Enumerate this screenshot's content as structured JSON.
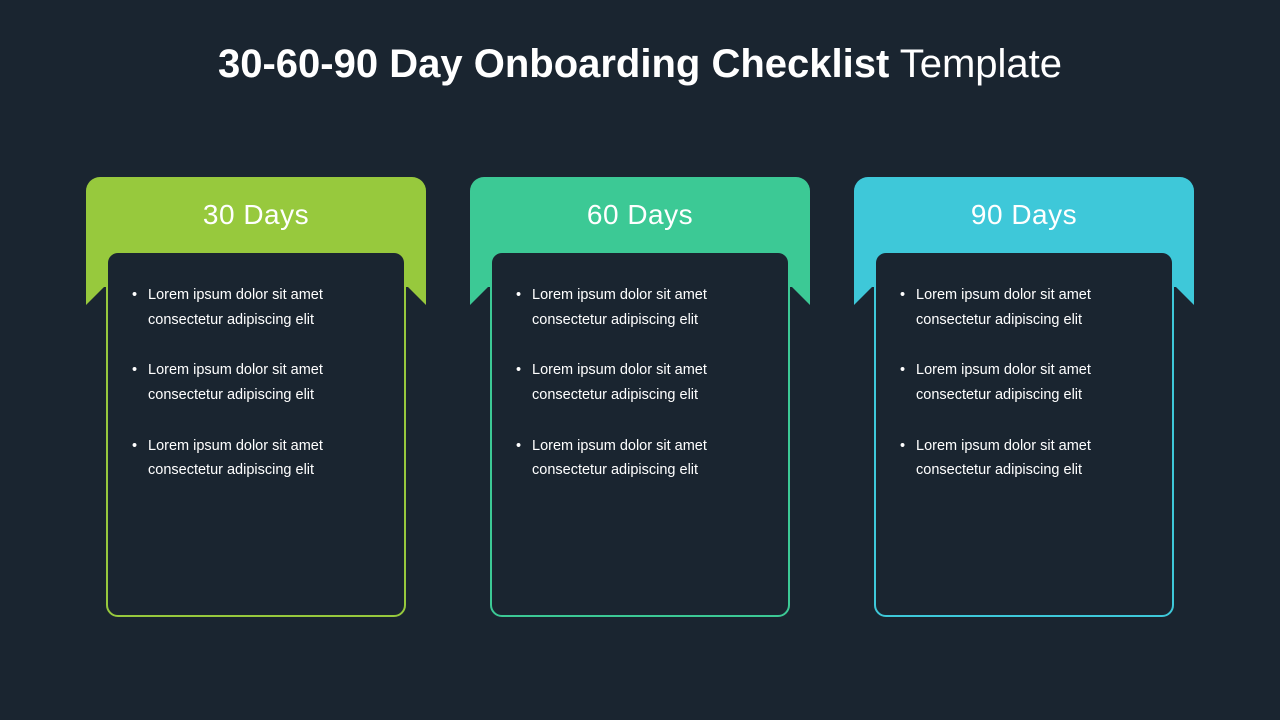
{
  "title_bold": "30-60-90 Day Onboarding Checklist",
  "title_light": " Template",
  "cards": [
    {
      "header": "30 Days",
      "items": [
        "Lorem ipsum dolor sit amet consectetur adipiscing elit",
        "Lorem ipsum dolor sit amet consectetur adipiscing elit",
        "Lorem ipsum dolor sit amet consectetur adipiscing elit"
      ],
      "color": "#97c93d"
    },
    {
      "header": "60 Days",
      "items": [
        "Lorem ipsum dolor sit amet consectetur adipiscing elit",
        "Lorem ipsum dolor sit amet consectetur adipiscing elit",
        "Lorem ipsum dolor sit amet consectetur adipiscing elit"
      ],
      "color": "#3cc995"
    },
    {
      "header": "90 Days",
      "items": [
        "Lorem ipsum dolor sit amet consectetur adipiscing elit",
        "Lorem ipsum dolor sit amet consectetur adipiscing elit",
        "Lorem ipsum dolor sit amet consectetur adipiscing elit"
      ],
      "color": "#3ec8d9"
    }
  ]
}
